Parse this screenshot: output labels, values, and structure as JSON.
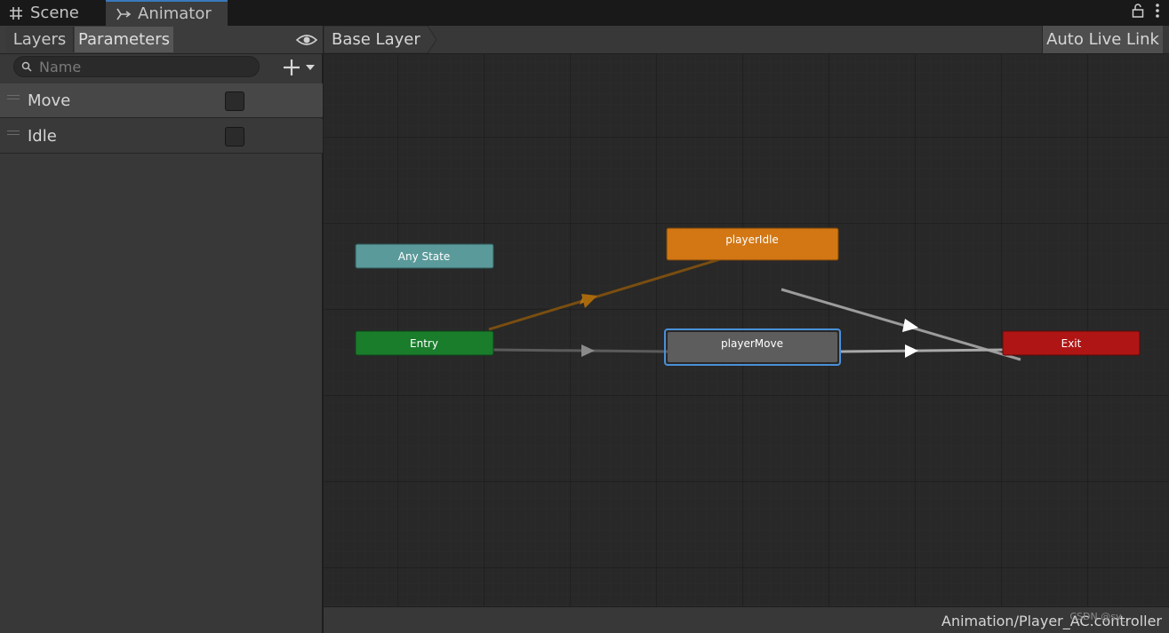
{
  "tabs": [
    {
      "label": "Scene",
      "icon": "grid-icon"
    },
    {
      "label": "Animator",
      "icon": "animator-icon"
    }
  ],
  "toolbar_right": {
    "lock_icon": "lock-icon",
    "menu_icon": "kebab-menu-icon"
  },
  "left_panel": {
    "tabs": {
      "layers": "Layers",
      "parameters": "Parameters"
    },
    "visibility_icon": "eye-icon",
    "search": {
      "placeholder": "Name",
      "value": ""
    },
    "add_icon": "plus-dropdown-icon",
    "parameters": [
      {
        "name": "Move",
        "checked": false
      },
      {
        "name": "Idle",
        "checked": false
      }
    ]
  },
  "graph": {
    "breadcrumb": "Base Layer",
    "auto_live_link": "Auto Live Link",
    "states": {
      "any_state": "Any State",
      "entry": "Entry",
      "player_idle": "playerIdle",
      "player_move": "playerMove",
      "exit": "Exit"
    },
    "colors": {
      "any_state": "#5b9a9a",
      "entry": "#1a7d2c",
      "player_idle": "#d27714",
      "player_move": "#5d5d5d",
      "exit": "#b01515",
      "selected_outline": "#4a90d9"
    },
    "footer_path": "Animation/Player_AC.controller",
    "watermark": "CSDN @sy_"
  }
}
